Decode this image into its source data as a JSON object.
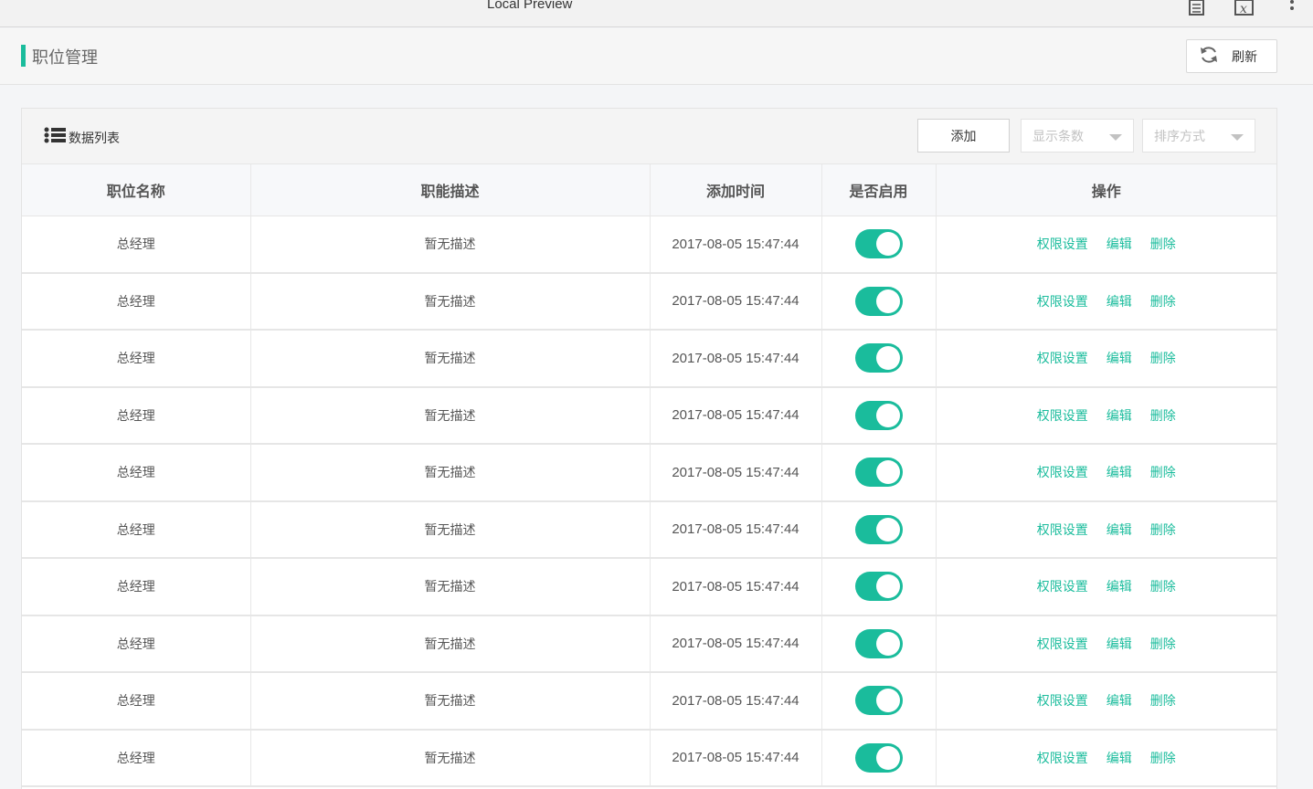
{
  "window": {
    "title": "Local Preview",
    "icons": [
      "document-icon",
      "formula-icon",
      "more-vertical-icon"
    ]
  },
  "header": {
    "title": "职位管理",
    "refresh_label": "刷新"
  },
  "panel": {
    "title": "数据列表",
    "add_label": "添加",
    "display_count_placeholder": "显示条数",
    "sort_placeholder": "排序方式"
  },
  "table": {
    "columns": [
      "职位名称",
      "职能描述",
      "添加时间",
      "是否启用",
      "操作"
    ],
    "actions": [
      "权限设置",
      "编辑",
      "删除"
    ],
    "rows": [
      {
        "name": "总经理",
        "desc": "暂无描述",
        "time": "2017-08-05 15:47:44",
        "enabled": true
      },
      {
        "name": "总经理",
        "desc": "暂无描述",
        "time": "2017-08-05 15:47:44",
        "enabled": true
      },
      {
        "name": "总经理",
        "desc": "暂无描述",
        "time": "2017-08-05 15:47:44",
        "enabled": true
      },
      {
        "name": "总经理",
        "desc": "暂无描述",
        "time": "2017-08-05 15:47:44",
        "enabled": true
      },
      {
        "name": "总经理",
        "desc": "暂无描述",
        "time": "2017-08-05 15:47:44",
        "enabled": true
      },
      {
        "name": "总经理",
        "desc": "暂无描述",
        "time": "2017-08-05 15:47:44",
        "enabled": true
      },
      {
        "name": "总经理",
        "desc": "暂无描述",
        "time": "2017-08-05 15:47:44",
        "enabled": true
      },
      {
        "name": "总经理",
        "desc": "暂无描述",
        "time": "2017-08-05 15:47:44",
        "enabled": true
      },
      {
        "name": "总经理",
        "desc": "暂无描述",
        "time": "2017-08-05 15:47:44",
        "enabled": true
      },
      {
        "name": "总经理",
        "desc": "暂无描述",
        "time": "2017-08-05 15:47:44",
        "enabled": true
      }
    ]
  },
  "colors": {
    "accent": "#1abc9c",
    "background": "#f4f5f7"
  }
}
